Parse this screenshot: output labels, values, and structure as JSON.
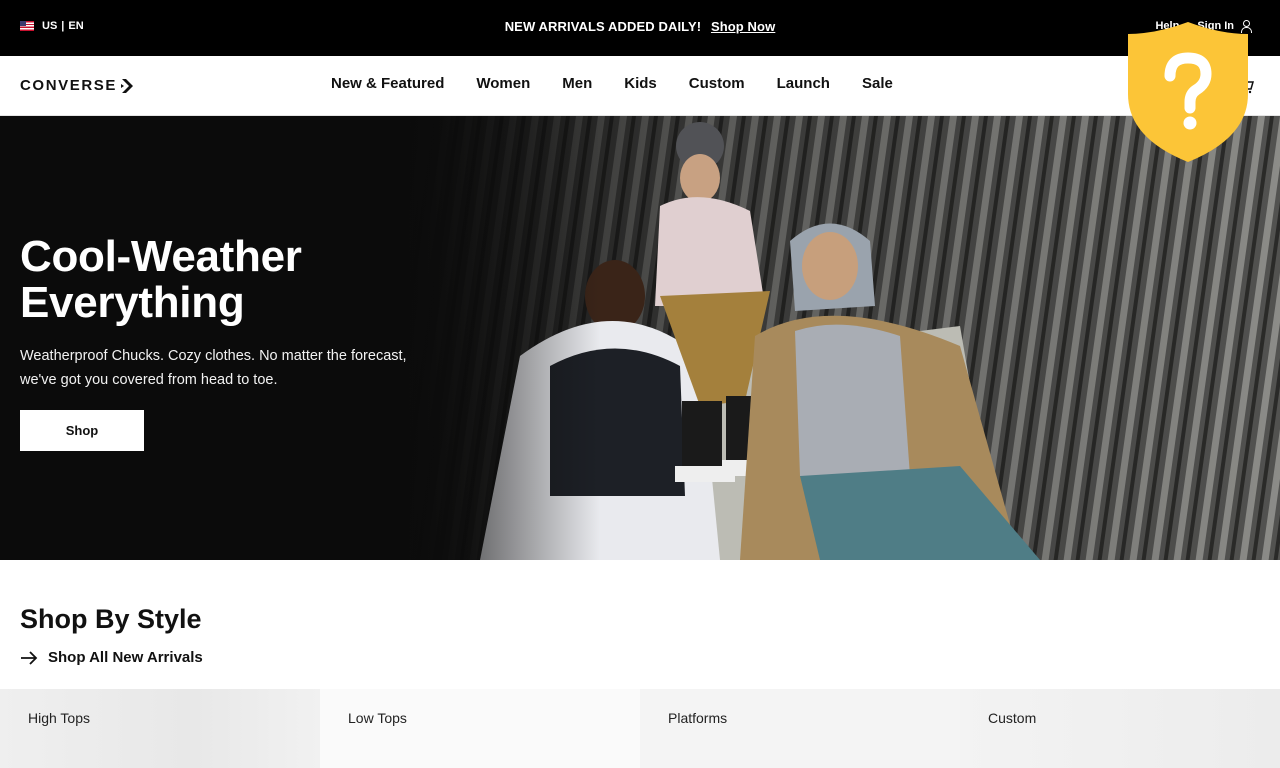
{
  "topbar": {
    "locale_country": "US",
    "locale_sep": "|",
    "locale_lang": "EN",
    "promo_text": "NEW ARRIVALS ADDED DAILY!",
    "promo_link": "Shop Now",
    "help": "Help",
    "sign_in": "Sign In"
  },
  "header": {
    "logo": "CONVERSE",
    "nav": [
      "New & Featured",
      "Women",
      "Men",
      "Kids",
      "Custom",
      "Launch",
      "Sale"
    ]
  },
  "hero": {
    "title": "Cool-Weather Everything",
    "subtitle": "Weatherproof Chucks. Cozy clothes. No matter the forecast, we've got you covered from head to toe.",
    "button": "Shop"
  },
  "shop_by_style": {
    "title": "Shop By Style",
    "link": "Shop All New Arrivals",
    "tiles": [
      "High Tops",
      "Low Tops",
      "Platforms",
      "Custom"
    ]
  },
  "colors": {
    "topbar_bg": "#000000",
    "shield_yellow": "#FCC537",
    "hero_bg": "#0b0b0b"
  },
  "icons": [
    "us-flag-icon",
    "user-icon",
    "cart-icon",
    "arrow-right-icon",
    "shield-question-icon"
  ]
}
